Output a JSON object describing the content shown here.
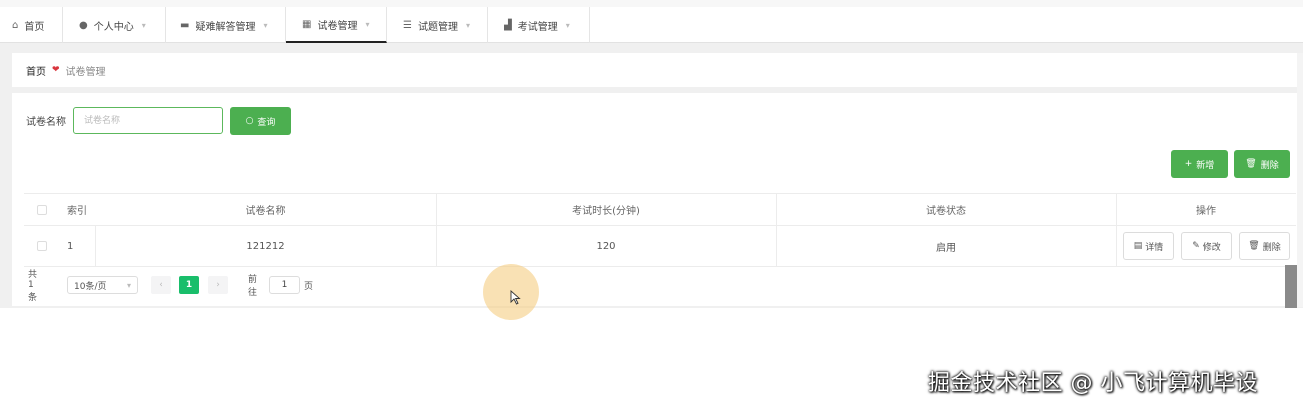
{
  "nav": {
    "tabs": [
      {
        "label": "首页",
        "icon": "home-icon"
      },
      {
        "label": "个人中心",
        "icon": "user-icon"
      },
      {
        "label": "疑难解答管理",
        "icon": "ticket-icon"
      },
      {
        "label": "试卷管理",
        "icon": "grid-icon",
        "active": true
      },
      {
        "label": "试题管理",
        "icon": "list-icon"
      },
      {
        "label": "考试管理",
        "icon": "chart-icon"
      }
    ]
  },
  "breadcrumb": {
    "home": "首页",
    "current": "试卷管理"
  },
  "search": {
    "label": "试卷名称",
    "placeholder": "试卷名称",
    "button": "查询"
  },
  "actions": {
    "add": "新增",
    "delete": "删除"
  },
  "table": {
    "columns": [
      "索引",
      "试卷名称",
      "考试时长(分钟)",
      "试卷状态",
      "操作"
    ],
    "rows": [
      {
        "index": "1",
        "name": "121212",
        "duration": "120",
        "status": "启用"
      }
    ],
    "row_actions": {
      "detail": "详情",
      "edit": "修改",
      "delete": "删除"
    }
  },
  "pagination": {
    "total": "共 1 条",
    "page_size": "10条/页",
    "current_page": "1",
    "goto_label": "前往",
    "goto_value": "1",
    "page_unit": "页"
  },
  "watermark": "掘金技术社区 @ 小飞计算机毕设",
  "colors": {
    "primary": "#4caf50",
    "page_active": "#19be6b",
    "heart": "#d9363e"
  }
}
